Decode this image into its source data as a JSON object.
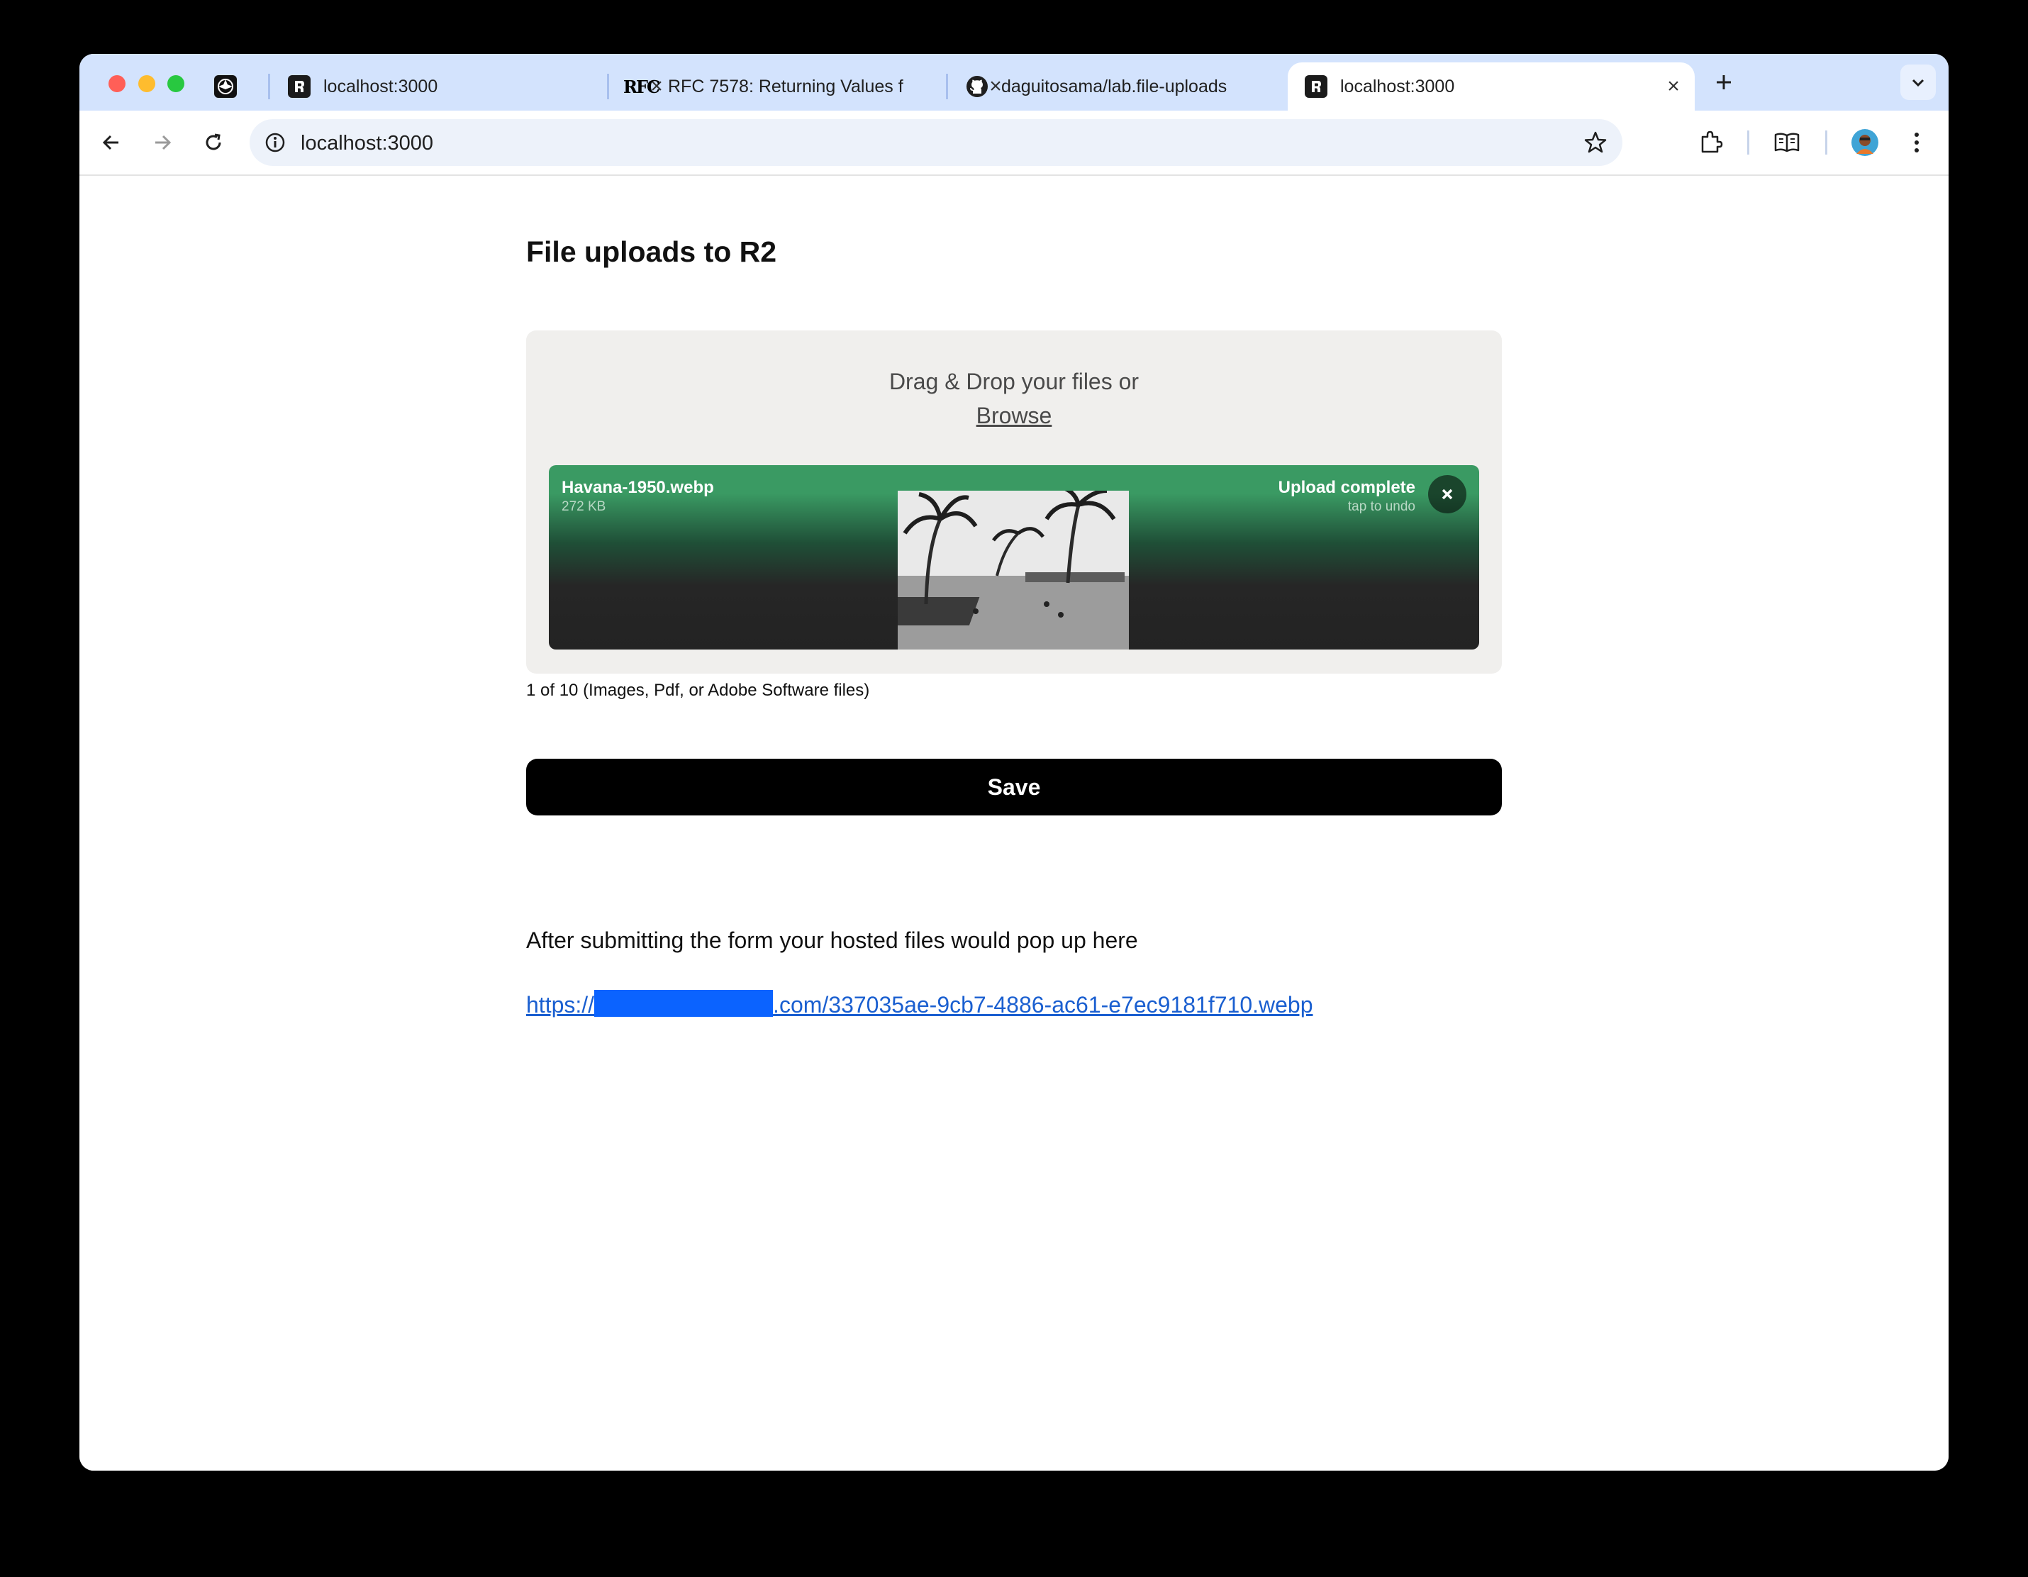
{
  "browser": {
    "tabs": [
      {
        "title": "",
        "favicon": "aperture-logo-icon",
        "active": false
      },
      {
        "title": "localhost:3000",
        "favicon": "remix-logo-icon",
        "active": false
      },
      {
        "title": "RFC 7578: Returning Values f",
        "favicon": "rfc-logo-icon",
        "favicon_text": "RFC",
        "active": false
      },
      {
        "title": "daguitosama/lab.file-uploads",
        "favicon": "github-logo-icon",
        "active": false
      },
      {
        "title": "localhost:3000",
        "favicon": "remix-logo-icon",
        "active": true
      }
    ],
    "address": "localhost:3000"
  },
  "page": {
    "title": "File uploads to R2",
    "dropzone": {
      "prompt": "Drag & Drop your files or",
      "browse_label": "Browse"
    },
    "file": {
      "name": "Havana-1950.webp",
      "size": "272 KB",
      "status": "Upload complete",
      "status_sub": "tap to undo"
    },
    "limit_note": "1 of 10 (Images, Pdf, or Adobe Software files)",
    "save_label": "Save",
    "after_text": "After submitting the form your hosted files would pop up here",
    "link": {
      "prefix": "https://",
      "suffix": ".com/337035ae-9cb7-4886-ac61-e7ec9181f710.webp"
    }
  },
  "colors": {
    "tabstrip": "#d3e3fd",
    "upload_success": "#3a9a63",
    "link": "#1a5fd0",
    "save_button": "#000000"
  }
}
